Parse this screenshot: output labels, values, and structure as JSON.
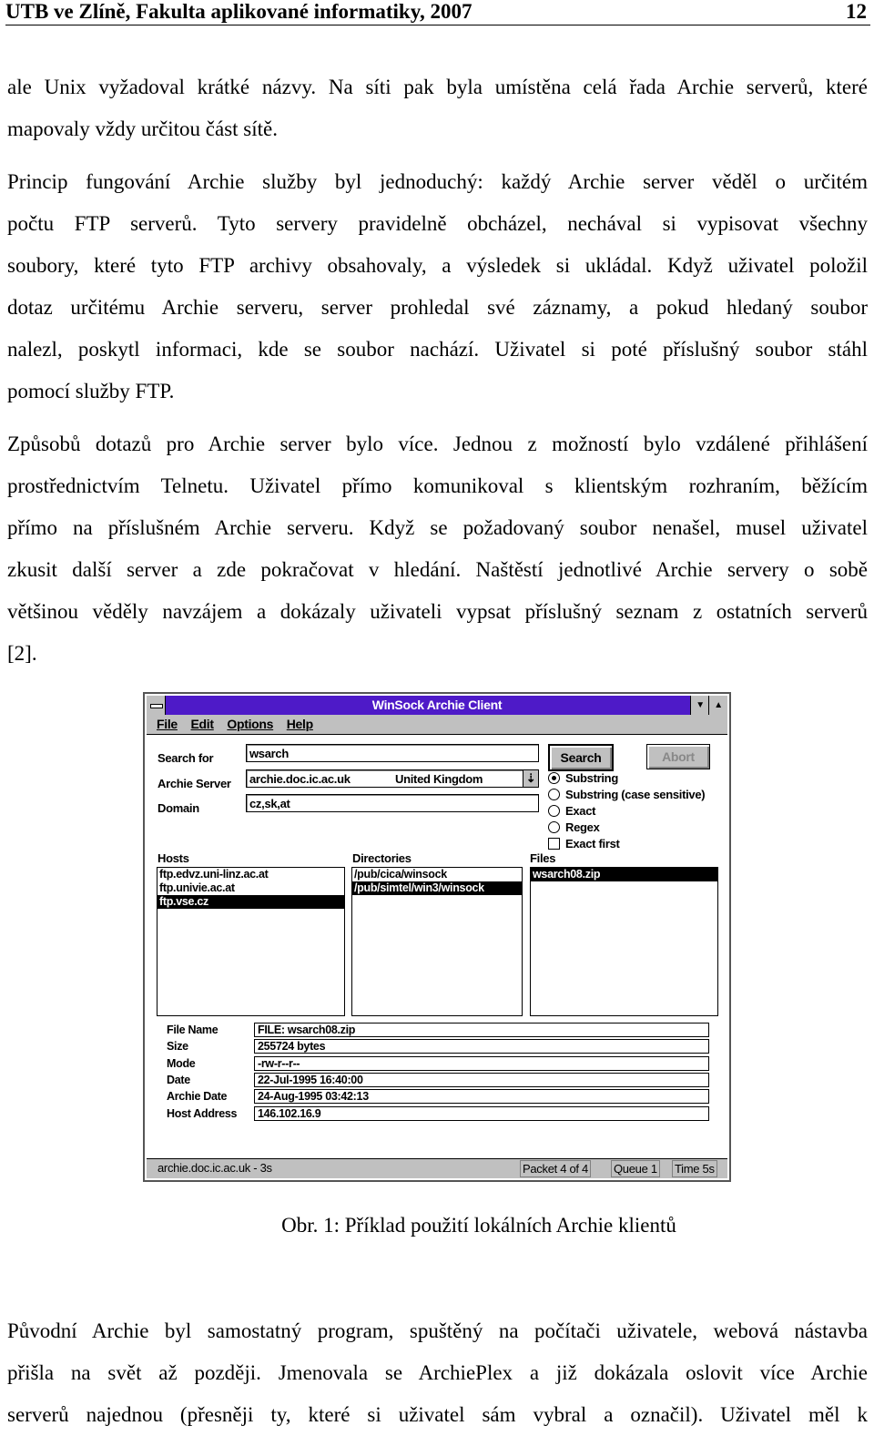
{
  "header": {
    "title": "UTB ve Zlíně, Fakulta aplikované informatiky, 2007",
    "page": "12"
  },
  "paragraphs": [
    [
      "ale Unix vyžadoval krátké názvy. Na síti pak byla umístěna celá řada Archie serverů, které",
      "mapovaly vždy určitou část sítě."
    ],
    [
      "Princip fungování Archie služby byl jednoduchý: každý Archie server věděl o určitém",
      "počtu FTP serverů. Tyto servery pravidelně obcházel, nechával si vypisovat všechny",
      "soubory, které tyto FTP archivy obsahovaly, a výsledek si ukládal. Když uživatel položil",
      "dotaz určitému Archie serveru, server prohledal své záznamy, a pokud hledaný soubor",
      "nalezl, poskytl informaci, kde se soubor nachází. Uživatel si poté příslušný soubor stáhl",
      "pomocí služby FTP."
    ],
    [
      "Způsobů dotazů pro Archie server bylo více. Jednou z možností bylo vzdálené přihlášení",
      "prostřednictvím Telnetu. Uživatel přímo komunikoval s klientským rozhraním, běžícím",
      "přímo na příslušném Archie serveru. Když se požadovaný soubor nenašel, musel uživatel",
      "zkusit další server a zde pokračovat v hledání. Naštěstí jednotlivé Archie servery o sobě",
      "většinou věděly navzájem a dokázaly uživateli vypsat příslušný seznam z ostatních serverů",
      "[2]."
    ],
    [
      "Původní Archie byl samostatný program, spuštěný na počítači uživatele, webová nástavba",
      "přišla na svět až později. Jmenovala se ArchiePlex a již dokázala oslovit více Archie",
      "serverů najednou (přesněji ty, které si uživatel sám vybral a označil). Uživatel měl k"
    ]
  ],
  "figure": {
    "caption": "Obr. 1: Příklad použití lokálních Archie klientů",
    "title_bar_color": "#4e1ac8",
    "window_title": "WinSock Archie Client",
    "menu": [
      "File",
      "Edit",
      "Options",
      "Help"
    ],
    "labels": {
      "search_for": "Search for",
      "archie_server": "Archie Server",
      "domain": "Domain",
      "hosts": "Hosts",
      "directories": "Directories",
      "files": "Files"
    },
    "search_value": "wsarch",
    "server_value": "archie.doc.ic.ac.uk",
    "server_country": "United Kingdom",
    "domain_value": "cz,sk,at",
    "search_button": "Search",
    "abort_button": "Abort",
    "options": [
      "Substring",
      "Substring (case sensitive)",
      "Exact",
      "Regex"
    ],
    "selected_option": "Substring",
    "exact_first": "Exact first",
    "hosts": [
      "ftp.edvz.uni-linz.ac.at",
      "ftp.univie.ac.at",
      "ftp.vse.cz"
    ],
    "directories": [
      "/pub/cica/winsock",
      "/pub/simtel/win3/winsock"
    ],
    "files": [
      "wsarch08.zip"
    ],
    "details": [
      {
        "label": "File Name",
        "value": "FILE: wsarch08.zip"
      },
      {
        "label": "Size",
        "value": "255724 bytes"
      },
      {
        "label": "Mode",
        "value": "-rw-r--r--"
      },
      {
        "label": "Date",
        "value": "22-Jul-1995 16:40:00"
      },
      {
        "label": "Archie Date",
        "value": "24-Aug-1995 03:42:13"
      },
      {
        "label": "Host Address",
        "value": "146.102.16.9"
      }
    ],
    "status": {
      "main": "archie.doc.ic.ac.uk - 3s",
      "packet": "Packet 4 of 4",
      "queue": "Queue 1",
      "time": "Time 5s"
    }
  }
}
